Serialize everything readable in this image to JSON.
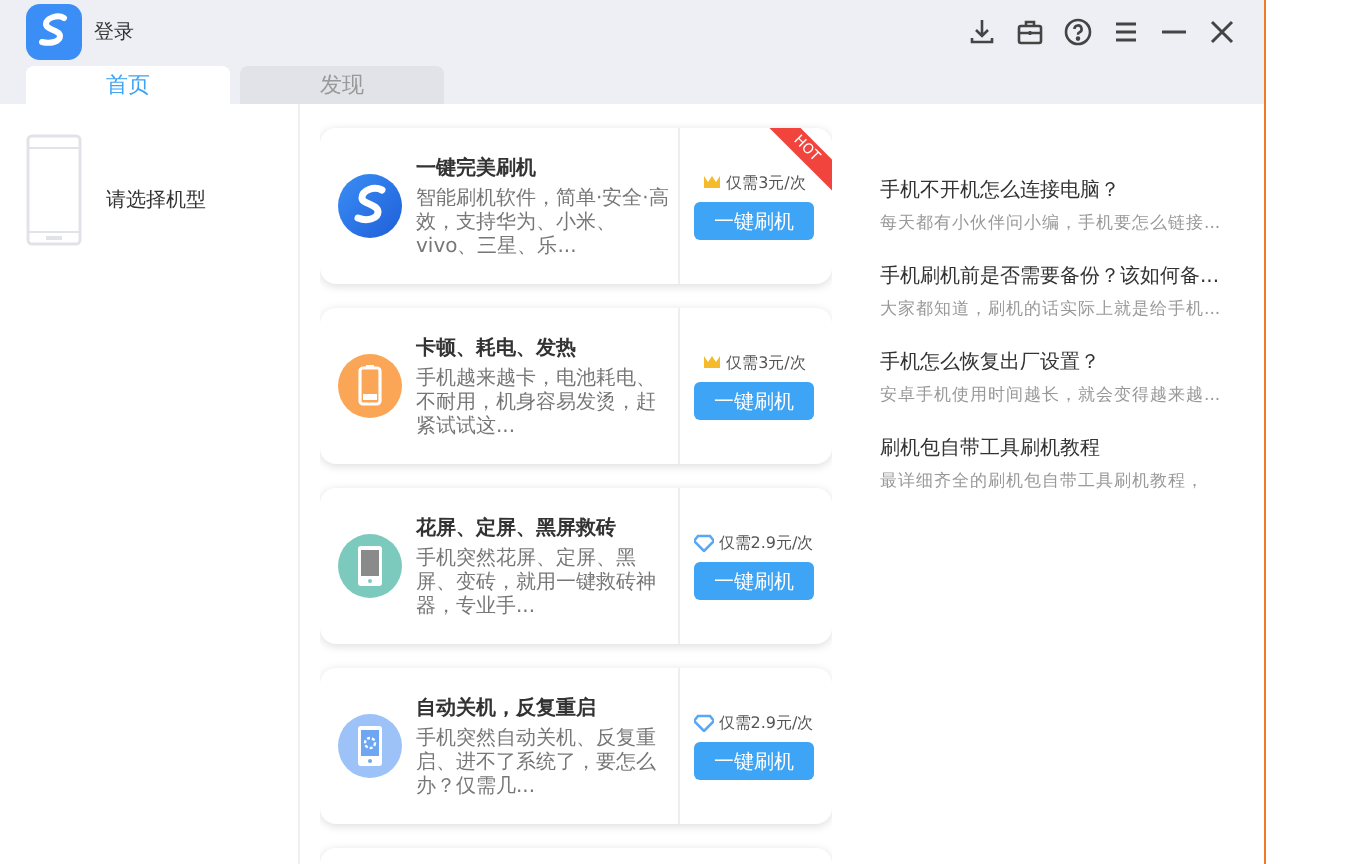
{
  "window": {
    "title": "登录"
  },
  "title_bar_buttons": [
    {
      "kind": "download"
    },
    {
      "kind": "briefcase"
    },
    {
      "kind": "help"
    },
    {
      "kind": "menu"
    },
    {
      "kind": "minimize"
    },
    {
      "kind": "close"
    }
  ],
  "tabs": [
    {
      "label": "首页",
      "selected": true
    },
    {
      "label": "发现",
      "selected": false
    }
  ],
  "sidebar": {
    "label": "请选择机型"
  },
  "cards": [
    {
      "kind": "logo",
      "title": "一键完美刷机",
      "description": "智能刷机软件，简单·安全·高效，支持华为、小米、vivo、三星、乐...",
      "price": {
        "kind": "crown",
        "text": "仅需3元/次"
      },
      "button": "一键刷机",
      "ribbon": "HOT"
    },
    {
      "kind": "battery",
      "title": "卡顿、耗电、发热",
      "description": "手机越来越卡，电池耗电、不耐用，机身容易发烫，赶紧试试这...",
      "price": {
        "kind": "crown",
        "text": "仅需3元/次"
      },
      "button": "一键刷机"
    },
    {
      "kind": "phone",
      "title": "花屏、定屏、黑屏救砖",
      "description": "手机突然花屏、定屏、黑屏、变砖，就用一键救砖神器，专业手...",
      "price": {
        "kind": "diamond",
        "text": "仅需2.9元/次"
      },
      "button": "一键刷机"
    },
    {
      "kind": "phone-gear",
      "title": "自动关机，反复重启",
      "description": "手机突然自动关机、反复重启、进不了系统了，要怎么办？仅需几...",
      "price": {
        "kind": "diamond",
        "text": "仅需2.9元/次"
      },
      "button": "一键刷机"
    }
  ],
  "articles": [
    {
      "title": "手机不开机怎么连接电脑？",
      "summary": "每天都有小伙伴问小编，手机要怎么链接..."
    },
    {
      "title": "手机刷机前是否需要备份？该如何备...",
      "summary": "大家都知道，刷机的话实际上就是给手机..."
    },
    {
      "title": "手机怎么恢复出厂设置？",
      "summary": "安卓手机使用时间越长，就会变得越来越..."
    },
    {
      "title": "刷机包自带工具刷机教程",
      "summary": "最详细齐全的刷机包自带工具刷机教程，"
    }
  ]
}
